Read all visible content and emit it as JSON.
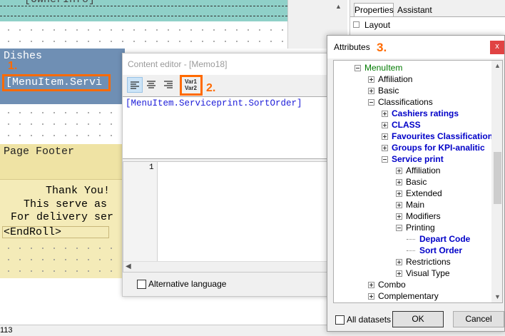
{
  "report": {
    "top_field": "[OwnerInfo]",
    "dishes_label": "Dishes",
    "dishes_field": "[MenuItem.Servi",
    "page_footer_label": "Page Footer",
    "footer_line1": "Thank You!",
    "footer_line2": "This serve as",
    "footer_line3": "For delivery ser",
    "endroll": "<EndRoll>"
  },
  "annotations": {
    "one": "1.",
    "two": "2.",
    "three": "3."
  },
  "content_editor": {
    "title": "Content editor - [Memo18]",
    "var_button_line1": "Var1",
    "var_button_line2": "Var2",
    "expression": "[MenuItem.Serviceprint.SortOrder]",
    "line_number": "1",
    "alt_language_label": "Alternative language"
  },
  "inspector": {
    "tabs": [
      "Properties",
      "Assistant"
    ],
    "layout_label": "Layout"
  },
  "attributes": {
    "title": "Attributes",
    "close_symbol": "x",
    "tree": [
      {
        "label": "MenuItem",
        "level": 0,
        "state": "open",
        "bold": false,
        "green": true
      },
      {
        "label": "Affiliation",
        "level": 1,
        "state": "closed",
        "bold": false
      },
      {
        "label": "Basic",
        "level": 1,
        "state": "closed",
        "bold": false
      },
      {
        "label": "Classifications",
        "level": 1,
        "state": "open",
        "bold": false
      },
      {
        "label": "Cashiers ratings",
        "level": 2,
        "state": "closed",
        "bold": true
      },
      {
        "label": "CLASS",
        "level": 2,
        "state": "closed",
        "bold": true
      },
      {
        "label": "Favourites Classification",
        "level": 2,
        "state": "closed",
        "bold": true
      },
      {
        "label": "Groups for KPI-analitic",
        "level": 2,
        "state": "closed",
        "bold": true
      },
      {
        "label": "Service print",
        "level": 2,
        "state": "open",
        "bold": true
      },
      {
        "label": "Affiliation",
        "level": 3,
        "state": "closed",
        "bold": false
      },
      {
        "label": "Basic",
        "level": 3,
        "state": "closed",
        "bold": false
      },
      {
        "label": "Extended",
        "level": 3,
        "state": "closed",
        "bold": false
      },
      {
        "label": "Main",
        "level": 3,
        "state": "closed",
        "bold": false
      },
      {
        "label": "Modifiers",
        "level": 3,
        "state": "closed",
        "bold": false
      },
      {
        "label": "Printing",
        "level": 3,
        "state": "open",
        "bold": false
      },
      {
        "label": "Depart Code",
        "level": 4,
        "state": "leaf",
        "bold": true
      },
      {
        "label": "Sort Order",
        "level": 4,
        "state": "leaf",
        "bold": true
      },
      {
        "label": "Restrictions",
        "level": 3,
        "state": "closed",
        "bold": false
      },
      {
        "label": "Visual Type",
        "level": 3,
        "state": "closed",
        "bold": false
      },
      {
        "label": "Combo",
        "level": 1,
        "state": "closed",
        "bold": false
      },
      {
        "label": "Complementary",
        "level": 1,
        "state": "closed",
        "bold": false
      }
    ],
    "all_datasets_label": "All datasets",
    "ok_label": "OK",
    "cancel_label": "Cancel"
  },
  "status_bar": {
    "text": "113"
  },
  "colors": {
    "accent": "#ff6a00",
    "band_blue": "#6f8fb4",
    "band_teal": "#8fd0c8",
    "footer_yellow": "#f4ebb8",
    "close_red": "#e04343",
    "tree_blue": "#0000c8",
    "tree_green": "#007a00"
  }
}
